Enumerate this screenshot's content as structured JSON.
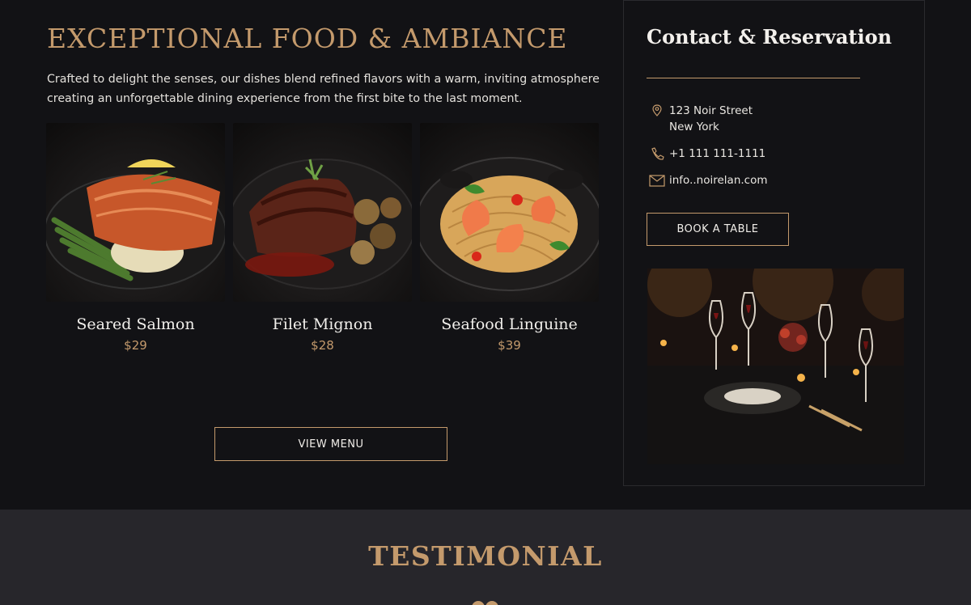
{
  "food": {
    "heading": "EXCEPTIONAL FOOD & AMBIANCE",
    "intro": "Crafted to delight the senses, our dishes blend refined flavors with a warm, inviting atmosphere creating an unforgettable dining experience from the first bite to the last moment.",
    "dishes": [
      {
        "name": "Seared Salmon",
        "price": "$29"
      },
      {
        "name": "Filet Mignon",
        "price": "$28"
      },
      {
        "name": "Seafood Linguine",
        "price": "$39"
      }
    ],
    "view_menu_label": "VIEW MENU"
  },
  "contact": {
    "title": "Contact & Reservation",
    "address_line1": "123 Noir Street",
    "address_line2": "New York",
    "phone": "+1 111 111-1111",
    "email": "info..noirelan.com",
    "book_label": "BOOK A TABLE",
    "icons": [
      "location-pin-icon",
      "phone-icon",
      "mail-icon"
    ]
  },
  "testimonial": {
    "title": "TESTIMONIAL",
    "icon": "quote-icon"
  },
  "colors": {
    "background": "#121215",
    "accent": "#c49a6c",
    "section_alt": "#27262b"
  }
}
